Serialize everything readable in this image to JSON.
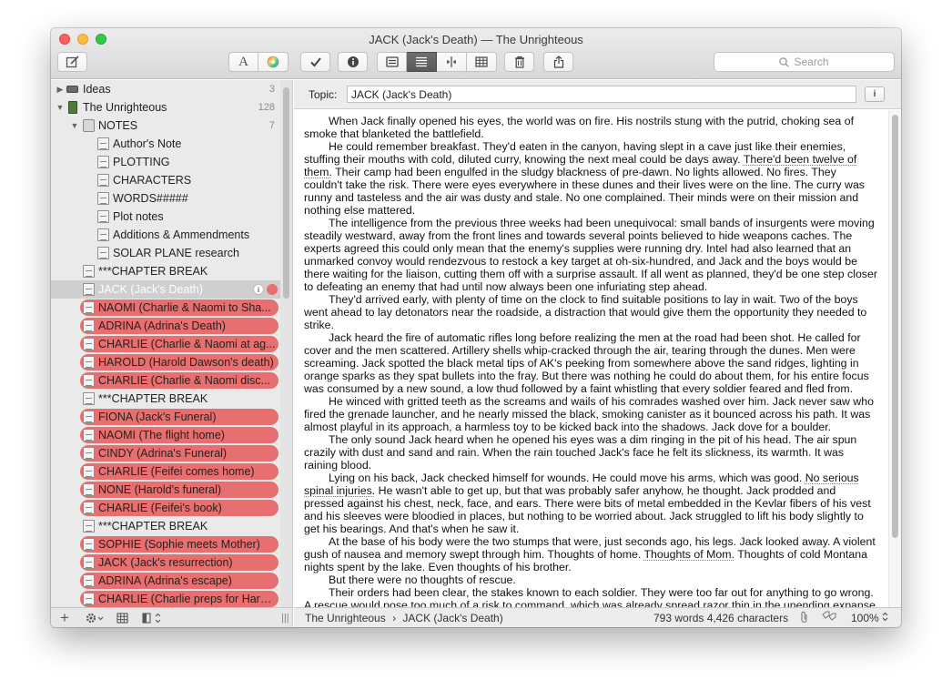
{
  "window": {
    "title": "JACK (Jack's Death) — The Unrighteous"
  },
  "toolbar": {
    "font_label": "A",
    "search_placeholder": "Search"
  },
  "binder": {
    "rows": [
      {
        "label": "Ideas",
        "count": "3"
      },
      {
        "label": "The Unrighteous",
        "count": "128"
      },
      {
        "label": "NOTES",
        "count": "7"
      },
      {
        "label": "Author's Note"
      },
      {
        "label": "PLOTTING"
      },
      {
        "label": "CHARACTERS"
      },
      {
        "label": "WORDS#####"
      },
      {
        "label": "Plot notes"
      },
      {
        "label": "Additions & Ammendments"
      },
      {
        "label": "SOLAR PLANE research"
      },
      {
        "label": "***CHAPTER BREAK"
      },
      {
        "label": "JACK (Jack's Death)"
      },
      {
        "label": "NAOMI (Charlie & Naomi to Sha..."
      },
      {
        "label": "ADRINA (Adrina's Death)"
      },
      {
        "label": "CHARLIE (Charlie & Naomi at ag..."
      },
      {
        "label": "HAROLD (Harold Dawson's death)"
      },
      {
        "label": "CHARLIE (Charlie & Naomi disc..."
      },
      {
        "label": "***CHAPTER BREAK"
      },
      {
        "label": "FIONA (Jack's Funeral)"
      },
      {
        "label": "NAOMI (The flight home)"
      },
      {
        "label": "CINDY (Adrina's Funeral)"
      },
      {
        "label": "CHARLIE (Feifei comes home)"
      },
      {
        "label": "NONE (Harold's funeral)"
      },
      {
        "label": "CHARLIE (Feifei's book)"
      },
      {
        "label": "***CHAPTER BREAK"
      },
      {
        "label": "SOPHIE (Sophie meets Mother)"
      },
      {
        "label": "JACK (Jack's resurrection)"
      },
      {
        "label": "ADRINA (Adrina's escape)"
      },
      {
        "label": "CHARLIE (Charlie preps for Harold)"
      }
    ],
    "label_color": "#e76f6f"
  },
  "topic": {
    "label": "Topic:",
    "value": "JACK (Jack's Death)"
  },
  "editor": {
    "p1": "When Jack finally opened his eyes, the world was on fire. His nostrils stung with the putrid, choking sea of smoke that blanketed the battlefield.",
    "p2a": "He could remember breakfast. They'd eaten in the canyon, having slept in a cave just like their enemies, stuffing their mouths with cold, diluted curry, knowing the next meal could be days away. ",
    "p2b": "There'd been twelve of them.",
    "p2c": " Their camp had been engulfed in the sludgy blackness of pre-dawn. No lights allowed. No fires. They couldn't take the risk. There were eyes everywhere in these dunes and their lives were on the line. The curry was runny and tasteless and the air was dusty and stale. No one complained. Their minds were on their mission and nothing else mattered.",
    "p3": "The intelligence from the previous three weeks had been unequivocal: small bands of insurgents were moving steadily westward, away from the front lines and towards several points believed to hide weapons caches. The experts agreed this could only mean that the enemy's supplies were running dry. Intel had also learned that an unmarked convoy would rendezvous to restock a key target at oh-six-hundred, and Jack and the boys would be there waiting for the liaison, cutting them off with a surprise assault. If all went as planned, they'd be one step closer to defeating an enemy that had until now always been one infuriating step ahead.",
    "p4": "They'd arrived early, with plenty of time on the clock to find suitable positions to lay in wait. Two of the boys went ahead to lay detonators near the roadside, a distraction that would give them the opportunity they needed to strike.",
    "p5": "Jack heard the fire of automatic rifles long before realizing the men at the road had been shot. He called for cover and the men scattered. Artillery shells whip-cracked through the air, tearing through the dunes. Men were screaming. Jack spotted the black metal tips of AK's peeking from somewhere above the sand ridges, lighting in orange sparks as they spat bullets into the fray. But there was nothing he could do about them, for his entire focus was consumed by a new sound, a low thud followed by a faint whistling that every soldier feared and fled from.",
    "p6": "He winced with gritted teeth as the screams and wails of his comrades washed over him. Jack never saw who fired the grenade launcher, and he nearly missed the black, smoking canister as it bounced across his path. It was almost playful in its approach, a harmless toy to be kicked back into the shadows. Jack dove for a boulder.",
    "p7": "The only sound Jack heard when he opened his eyes was a dim ringing in the pit of his head. The air spun crazily with dust and sand and rain. When the rain touched Jack's face he felt its slickness, its warmth. It was raining blood.",
    "p8a": "Lying on his back, Jack checked himself for wounds. He could move his arms, which was good. ",
    "p8b": "No serious spinal injuries.",
    "p8c": " He wasn't able to get up, but that was probably safer anyhow, he thought. Jack prodded and pressed against his chest, neck, face, and ears. There were bits of metal embedded in the Kevlar fibers of his vest and his sleeves were bloodied in places, but nothing to be worried about. Jack struggled to lift his body slightly to get his bearings. And that's when he saw it.",
    "p9a": "At the base of his body were the two stumps that were, just seconds ago, his legs. Jack looked away. A violent gush of nausea and memory swept through him. Thoughts of home. ",
    "p9b": "Thoughts of Mom.",
    "p9c": " Thoughts of cold Montana nights spent by the lake. Even thoughts of his brother.",
    "p10": "But there were no thoughts of rescue.",
    "p11": "Their orders had been clear, the stakes known to each soldier. They were too far out for anything to go wrong. A rescue would pose too much of a risk to command, which was already spread razor thin in the unending expanse"
  },
  "footer": {
    "path_root": "The Unrighteous",
    "path_sep": "›",
    "path_doc": "JACK (Jack's Death)",
    "counts": "793 words 4,426 characters",
    "zoom": "100%"
  }
}
